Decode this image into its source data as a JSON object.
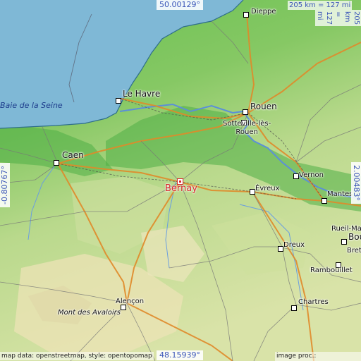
{
  "map": {
    "focus_place": "Bernay",
    "coords": {
      "north": "50.00129°",
      "south": "48.15939°",
      "west": "-0.80767°",
      "east": "2.00483°"
    },
    "scale": {
      "horizontal": "205 km = 127 mi",
      "vertical": "205 km = 127 mi"
    },
    "credits": {
      "left": "map data: openstreetmap, style: opentopomap",
      "right": "image proc.: elevation.city"
    },
    "sea_labels": [
      "Baie de la Seine"
    ],
    "places": [
      {
        "id": "dieppe",
        "name": "Dieppe"
      },
      {
        "id": "le-havre",
        "name": "Le Havre"
      },
      {
        "id": "rouen",
        "name": "Rouen"
      },
      {
        "id": "sotteville",
        "name": "Sotteville-lès-\nRouen"
      },
      {
        "id": "caen",
        "name": "Caen"
      },
      {
        "id": "bernay",
        "name": "Bernay"
      },
      {
        "id": "evreux",
        "name": "Évreux"
      },
      {
        "id": "vernon",
        "name": "Vernon"
      },
      {
        "id": "mantes",
        "name": "Mantes"
      },
      {
        "id": "rueil",
        "name": "Rueil-Malm"
      },
      {
        "id": "bou",
        "name": "Bou"
      },
      {
        "id": "bret",
        "name": "Bret"
      },
      {
        "id": "dreux",
        "name": "Dreux"
      },
      {
        "id": "rambouillet",
        "name": "Rambouillet"
      },
      {
        "id": "chartres",
        "name": "Chartres"
      },
      {
        "id": "alencon",
        "name": "Alençon"
      },
      {
        "id": "mont-avaloirs",
        "name": "Mont des Avaloirs"
      }
    ],
    "colors": {
      "sea": "#7fb8d6",
      "lowland": "#59b548",
      "upland": "#c3dd9a",
      "highland": "#ede4b8",
      "focus": "#d8272c",
      "coord_text": "#3a55b8"
    }
  }
}
